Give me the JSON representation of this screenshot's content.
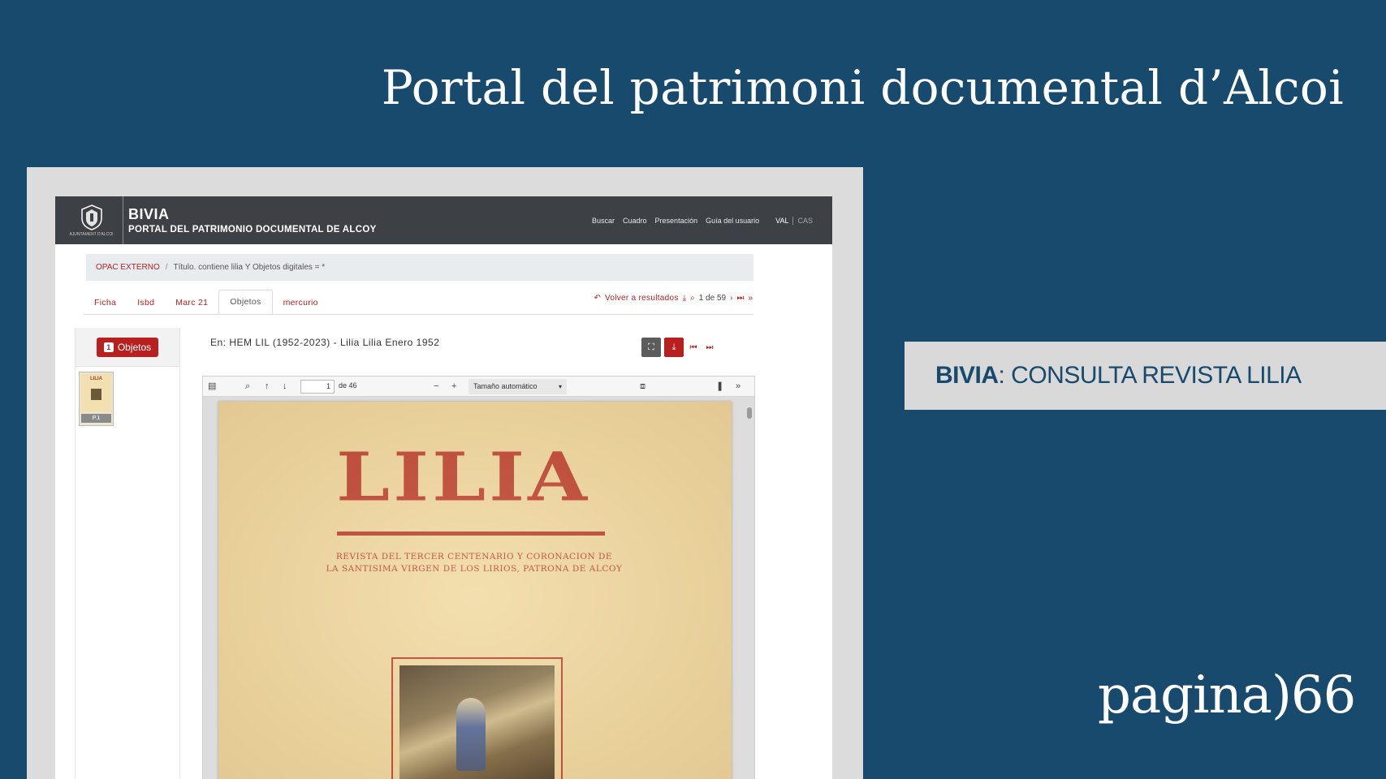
{
  "slide": {
    "title": "Portal del patrimoni documental d’Alcoi",
    "label_bold": "BIVIA",
    "label_rest": ": CONSULTA REVISTA LILIA",
    "brand": "pagina)66"
  },
  "header": {
    "logo_caption": "AJUNTAMENT D'ALCOI",
    "brand_name": "BIVIA",
    "brand_subtitle": "PORTAL DEL PATRIMONIO DOCUMENTAL DE ALCOY",
    "nav": [
      "Buscar",
      "Cuadro",
      "Presentación",
      "Guía del usuario"
    ],
    "lang_active": "VAL",
    "lang_other": "CAS"
  },
  "breadcrumb": {
    "root": "OPAC EXTERNO",
    "separator": "/",
    "query": "Título. contiene lilia Y Objetos digitales = *"
  },
  "tabs": [
    "Ficha",
    "Isbd",
    "Marc 21",
    "Objetos",
    "mercurio"
  ],
  "active_tab": "Objetos",
  "result_nav": {
    "back_label": "Volver a resultados",
    "count": "1 de 59"
  },
  "sidebar": {
    "objects_count": "1",
    "objects_label": "Objetos",
    "thumb_title": "LILIA",
    "thumb_page": "P.1"
  },
  "document": {
    "caption": "En: HEM LIL (1952-2023) - Lilia Lilia Enero 1952"
  },
  "viewer": {
    "page_current": "1",
    "page_total": "de 46",
    "zoom": "Tamaño automático"
  },
  "pdf": {
    "title": "LILIA",
    "subtitle_line1": "REVISTA DEL TERCER CENTENARIO Y CORONACION DE",
    "subtitle_line2": "LA SANTISIMA VIRGEN DE LOS LIRIOS, PATRONA DE ALCOY"
  },
  "colors": {
    "background": "#174a6c",
    "accent_red": "#b8201f",
    "header_dark": "#3d4044",
    "label_box": "#d9d9d9"
  }
}
